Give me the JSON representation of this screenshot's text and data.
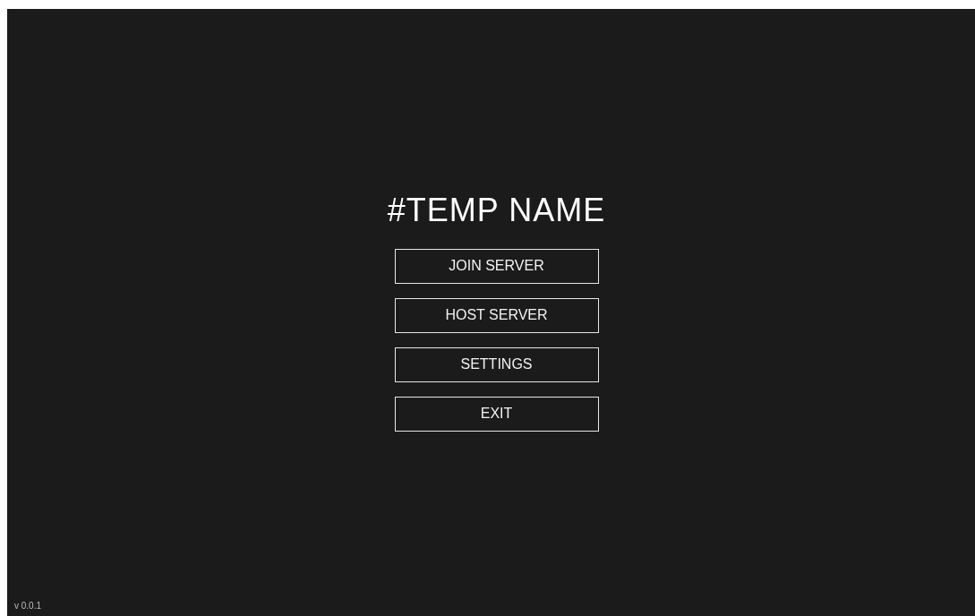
{
  "title": "#TEMP NAME",
  "buttons": [
    "JOIN SERVER",
    "HOST SERVER",
    "SETTINGS",
    "EXIT"
  ],
  "version": "v 0.0.1"
}
